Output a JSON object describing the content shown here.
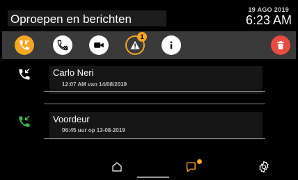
{
  "header": {
    "title": "Oproepen en berichten",
    "date": "19 AGO 2019",
    "time": "6:23 AM"
  },
  "toolbar": {
    "buttons": [
      {
        "name": "calls-filter",
        "icon": "phone-calls-icon",
        "active": true
      },
      {
        "name": "missed-calls-filter",
        "icon": "missed-call-icon"
      },
      {
        "name": "video-filter",
        "icon": "video-camera-icon"
      },
      {
        "name": "alerts-filter",
        "icon": "warning-icon",
        "badge": "1"
      },
      {
        "name": "info-filter",
        "icon": "info-icon"
      },
      {
        "name": "delete",
        "icon": "trash-icon"
      }
    ],
    "alert_badge": "1"
  },
  "list": {
    "items": [
      {
        "name": "Carlo Neri",
        "time": "12:07 AM van 14/08/2019",
        "icon": "incoming-call-icon",
        "icon_color": "#ffffff"
      },
      {
        "name": "Voordeur",
        "time": "06:45 uur op 13-08-2019",
        "icon": "incoming-call-icon",
        "icon_color": "#3fbf4a"
      }
    ]
  },
  "nav": {
    "items": [
      {
        "name": "home",
        "icon": "home-icon"
      },
      {
        "name": "messages",
        "icon": "message-icon",
        "indicator": true
      },
      {
        "name": "settings",
        "icon": "gear-icon"
      }
    ]
  },
  "colors": {
    "accent": "#f5a623",
    "delete": "#ea4b41",
    "toolbar": "#3a3a3a",
    "background": "#000000",
    "call_green": "#3fbf4a"
  }
}
